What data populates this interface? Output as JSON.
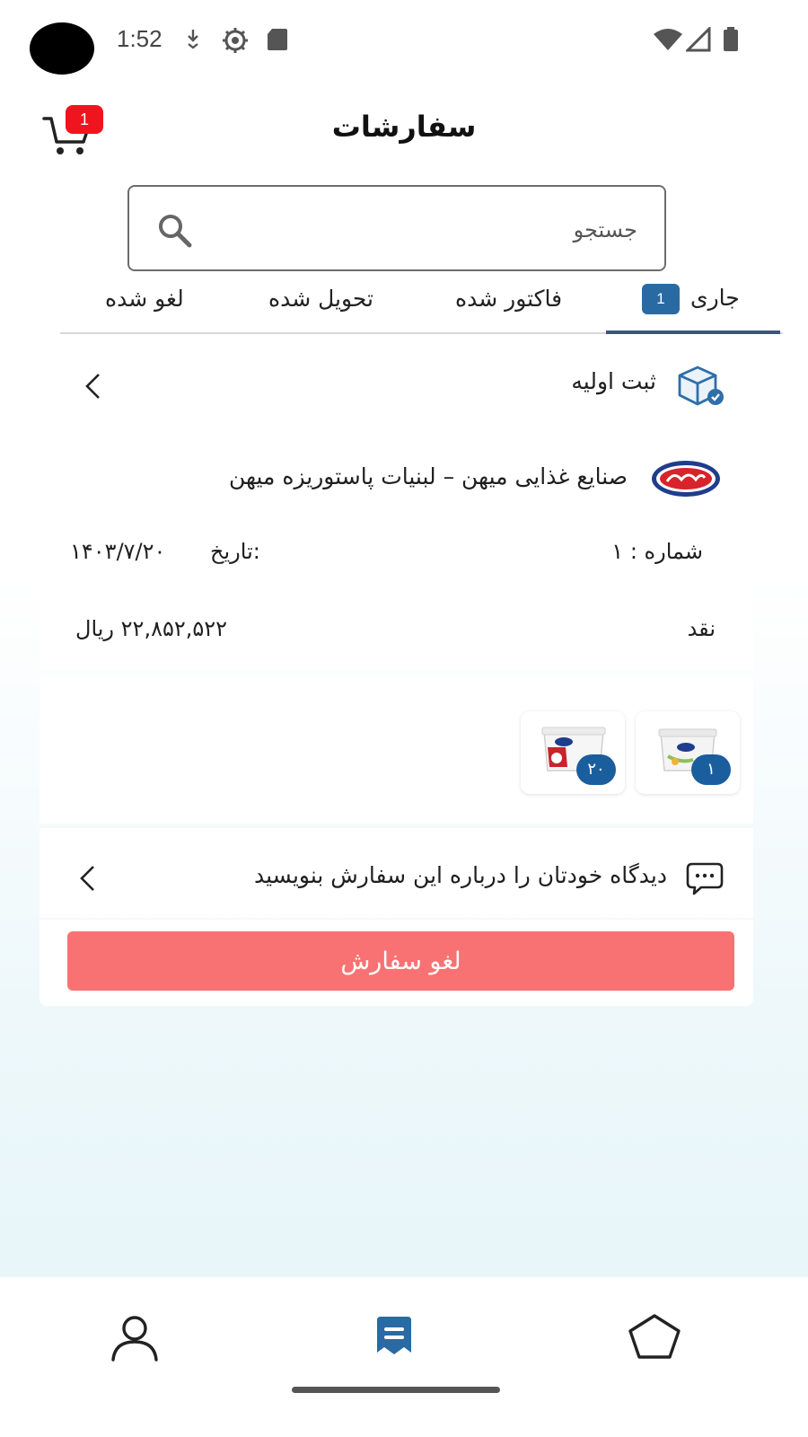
{
  "status_bar": {
    "time": "1:52",
    "icons": [
      "download-icon",
      "settings-gear-icon",
      "sd-card-icon",
      "wifi-icon",
      "cell-signal-icon",
      "battery-icon"
    ]
  },
  "header": {
    "title": "سفارشات",
    "cart_count": "1"
  },
  "search": {
    "placeholder": "جستجو"
  },
  "tabs": [
    {
      "label": "جاری",
      "badge": "1",
      "active": true
    },
    {
      "label": "فاکتور شده",
      "active": false
    },
    {
      "label": "تحویل شده",
      "active": false
    },
    {
      "label": "لغو شده",
      "active": false
    }
  ],
  "order": {
    "status_label": "ثبت اولیه",
    "supplier_name": "صنایع غذایی میهن – لبنیات پاستوریزه میهن",
    "number": "شماره : ۱",
    "date_label": "تاریخ:",
    "date": "۱۴۰۳/۷/۲۰",
    "payment_type": "نقد",
    "amount": "۲۲,۸۵۲,۵۲۲ ریال",
    "products": [
      {
        "qty": "۱"
      },
      {
        "qty": "۲۰"
      }
    ],
    "comment_prompt": "دیدگاه خودتان را درباره این سفارش بنویسید",
    "cancel_label": "لغو سفارش"
  },
  "colors": {
    "accent": "#2a6aa3",
    "tab_indicator": "#3c5480",
    "cancel": "#f87273",
    "badge_red": "#f0141e"
  },
  "bottom_nav": [
    "profile-icon",
    "orders-icon",
    "home-icon"
  ]
}
